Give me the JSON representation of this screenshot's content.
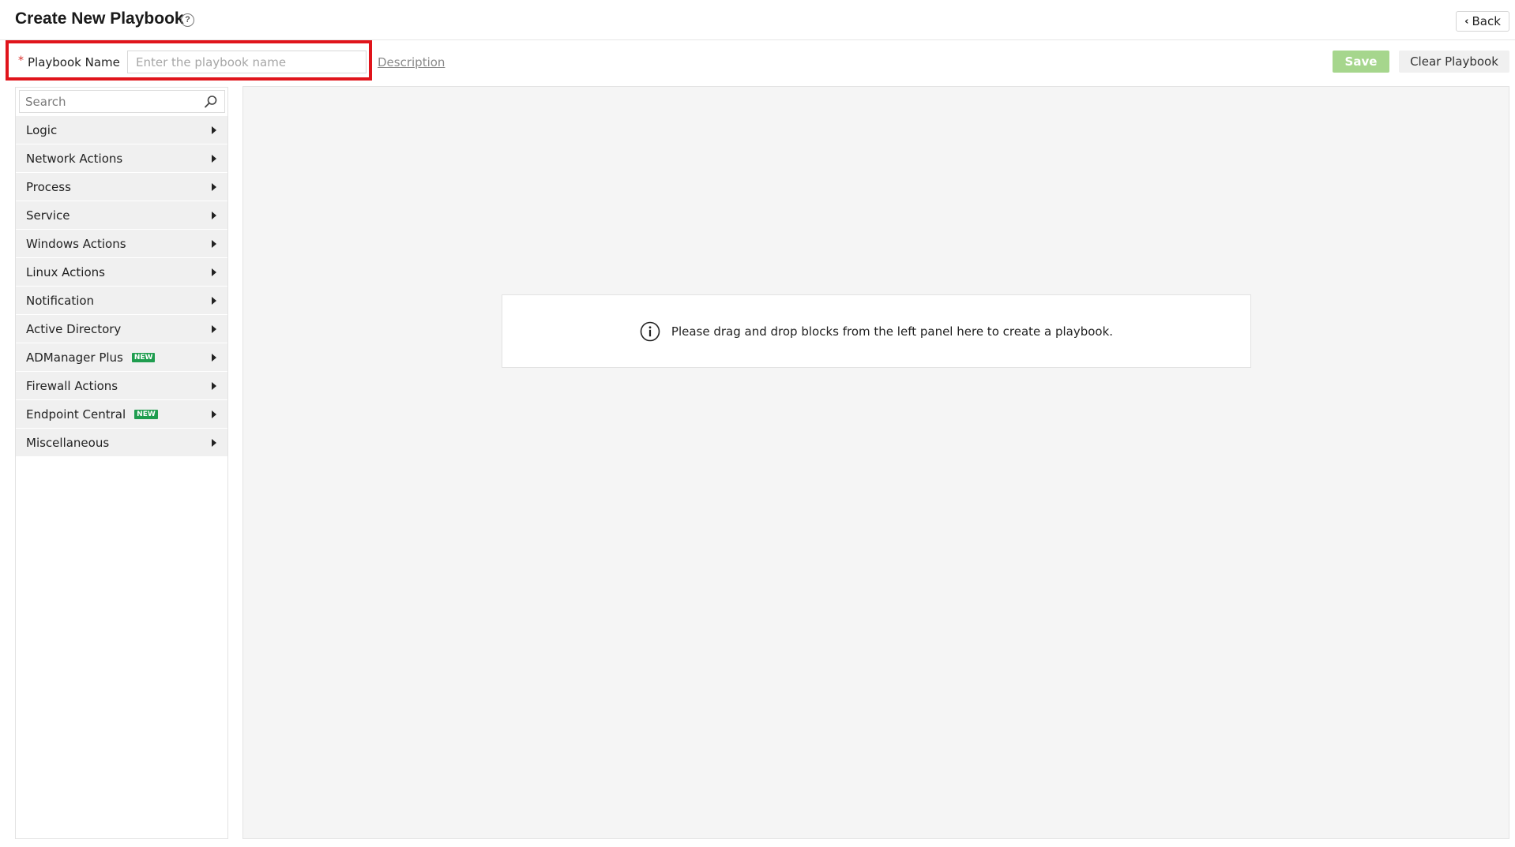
{
  "header": {
    "title": "Create New Playbook",
    "help_glyph": "?",
    "back_label": "Back"
  },
  "toolbar": {
    "required_marker": "*",
    "name_label": "Playbook Name",
    "name_value": "",
    "name_placeholder": "Enter the playbook name",
    "description_label": "Description",
    "save_label": "Save",
    "clear_label": "Clear Playbook"
  },
  "sidebar": {
    "search_placeholder": "Search",
    "new_badge": "NEW",
    "items": [
      {
        "label": "Logic",
        "is_new": false
      },
      {
        "label": "Network Actions",
        "is_new": false
      },
      {
        "label": "Process",
        "is_new": false
      },
      {
        "label": "Service",
        "is_new": false
      },
      {
        "label": "Windows Actions",
        "is_new": false
      },
      {
        "label": "Linux Actions",
        "is_new": false
      },
      {
        "label": "Notification",
        "is_new": false
      },
      {
        "label": "Active Directory",
        "is_new": false
      },
      {
        "label": "ADManager Plus",
        "is_new": true
      },
      {
        "label": "Firewall Actions",
        "is_new": false
      },
      {
        "label": "Endpoint Central",
        "is_new": true
      },
      {
        "label": "Miscellaneous",
        "is_new": false
      }
    ]
  },
  "canvas": {
    "empty_message": "Please drag and drop blocks from the left panel here to create a playbook."
  },
  "colors": {
    "highlight_border": "#e0141b",
    "save_button": "#a6d68d",
    "new_badge": "#1f9d4f",
    "canvas_background": "#f5f5f5",
    "sidebar_item_background": "#f0f0f0"
  },
  "icons": {
    "help": "question-circle-icon",
    "back": "chevron-left-icon",
    "search": "magnifier-icon",
    "category_caret": "caret-right-icon",
    "info": "info-circle-icon"
  }
}
